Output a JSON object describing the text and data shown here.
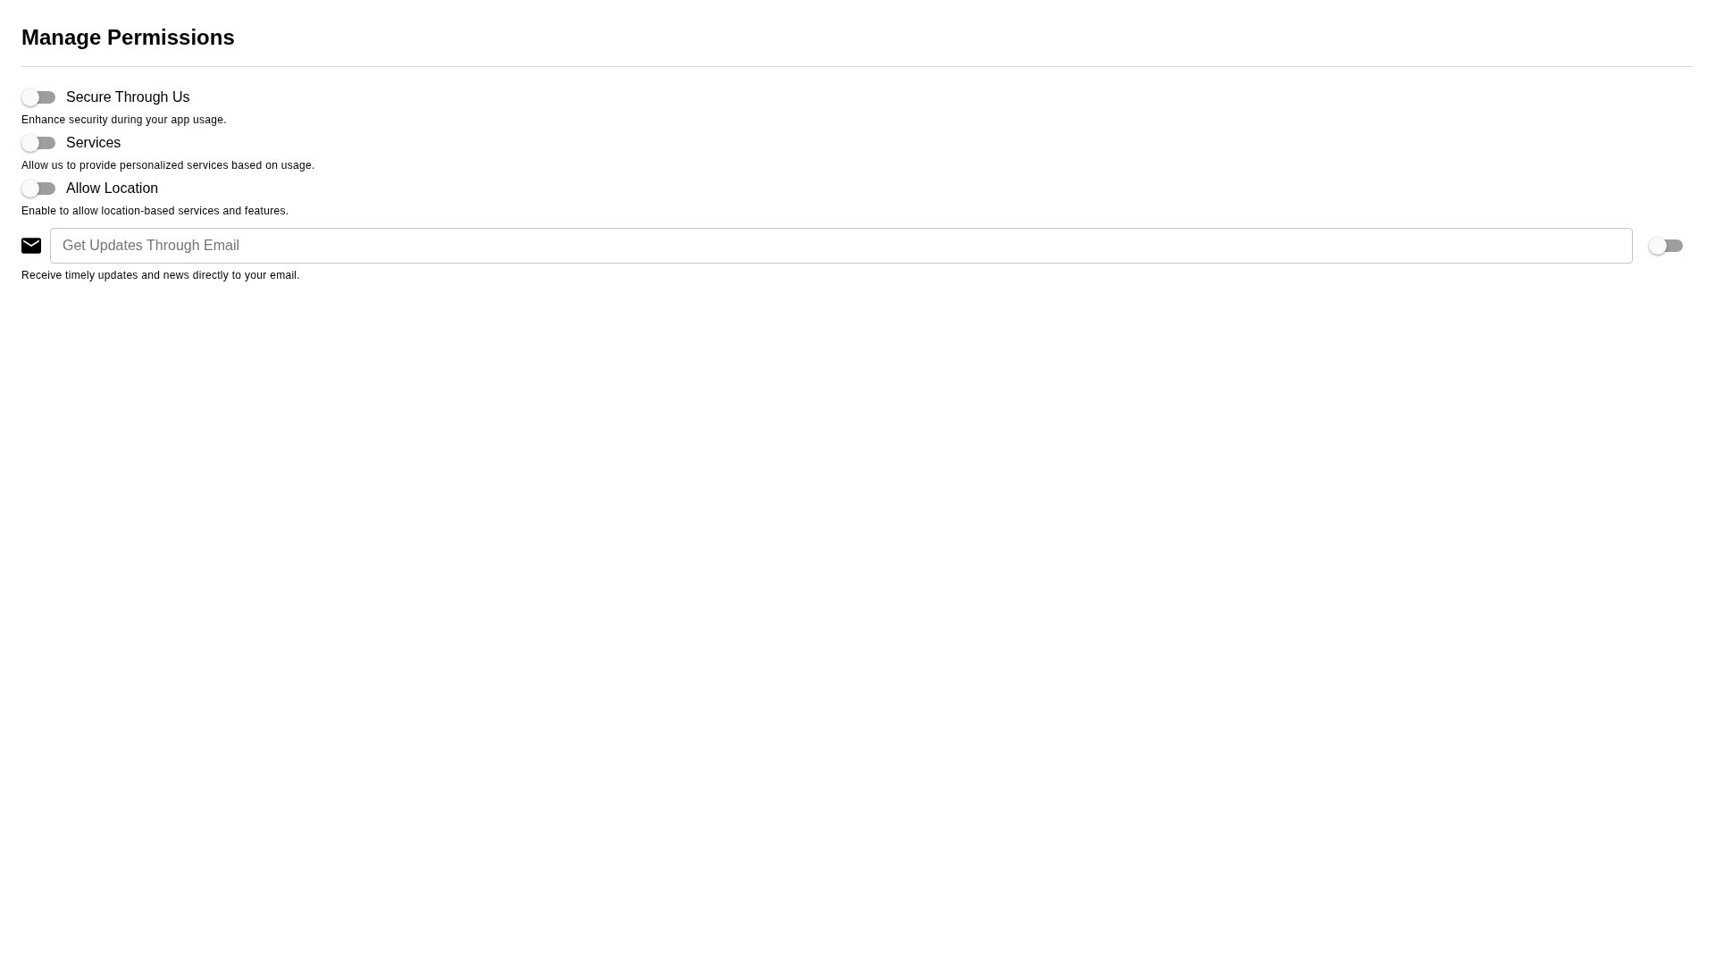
{
  "title": "Manage Permissions",
  "permissions": [
    {
      "label": "Secure Through Us",
      "description": "Enhance security during your app usage.",
      "on": false
    },
    {
      "label": "Services",
      "description": "Allow us to provide personalized services based on usage.",
      "on": false
    },
    {
      "label": "Allow Location",
      "description": "Enable to allow location-based services and features.",
      "on": false
    }
  ],
  "email": {
    "placeholder": "Get Updates Through Email",
    "description": "Receive timely updates and news directly to your email.",
    "on": false
  }
}
